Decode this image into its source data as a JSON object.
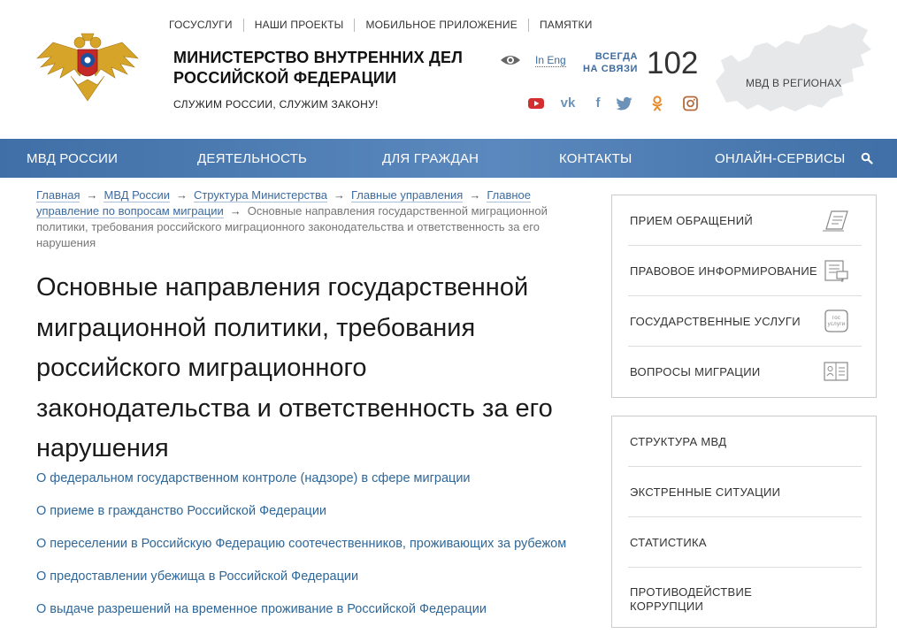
{
  "header": {
    "topnav": [
      "ГОСУСЛУГИ",
      "НАШИ ПРОЕКТЫ",
      "МОБИЛЬНОЕ ПРИЛОЖЕНИЕ",
      "ПАМЯТКИ"
    ],
    "title_line1": "МИНИСТЕРСТВО ВНУТРЕННИХ ДЕЛ",
    "title_line2": "РОССИЙСКОЙ ФЕДЕРАЦИИ",
    "slogan": "СЛУЖИМ РОССИИ, СЛУЖИМ ЗАКОНУ!",
    "lang_link": "In Eng",
    "always_line1": "ВСЕГДА",
    "always_line2": "НА СВЯЗИ",
    "phone": "102",
    "regions": "МВД В РЕГИОНАХ",
    "socials": [
      "youtube-icon",
      "vk-icon",
      "facebook-icon",
      "twitter-icon",
      "odnoklassniki-icon",
      "instagram-icon"
    ]
  },
  "mainnav": [
    "МВД РОССИИ",
    "ДЕЯТЕЛЬНОСТЬ",
    "ДЛЯ ГРАЖДАН",
    "КОНТАКТЫ",
    "ОНЛАЙН-СЕРВИСЫ"
  ],
  "breadcrumb": {
    "items": [
      "Главная",
      "МВД России",
      "Структура Министерства",
      "Главные управления",
      "Главное управление по вопросам миграции"
    ],
    "current": "Основные направления государственной миграционной политики, требования российского миграционного законодательства и ответственность за его нарушения"
  },
  "page_title": "Основные направления государственной миграционной политики, требования российского миграционного законодательства и ответственность за его нарушения",
  "links": [
    "О федеральном государственном контроле (надзоре) в сфере миграции",
    "О приеме в гражданство Российской Федерации",
    "О переселении в Российскую Федерацию соотечественников, проживающих за рубежом",
    "О предоставлении убежища в Российской Федерации",
    "О выдаче разрешений на временное проживание в Российской Федерации"
  ],
  "sidebar_services": [
    {
      "label": "ПРИЕМ ОБРАЩЕНИЙ",
      "icon": "pen-document-icon"
    },
    {
      "label": "ПРАВОВОЕ ИНФОРМИРОВАНИЕ",
      "icon": "legal-info-icon"
    },
    {
      "label": "ГОСУДАРСТВЕННЫЕ УСЛУГИ",
      "icon": "gosuslugi-icon",
      "icon_text1": "гос",
      "icon_text2": "услуги"
    },
    {
      "label": "ВОПРОСЫ МИГРАЦИИ",
      "icon": "passport-icon"
    }
  ],
  "sidebar_links": [
    "СТРУКТУРА МВД",
    "ЭКСТРЕННЫЕ СИТУАЦИИ",
    "СТАТИСТИКА",
    "ПРОТИВОДЕЙСТВИЕ КОРРУПЦИИ"
  ],
  "colors": {
    "nav": "#4a7ab1",
    "link": "#2f6798",
    "accent": "#3d6b9e"
  }
}
